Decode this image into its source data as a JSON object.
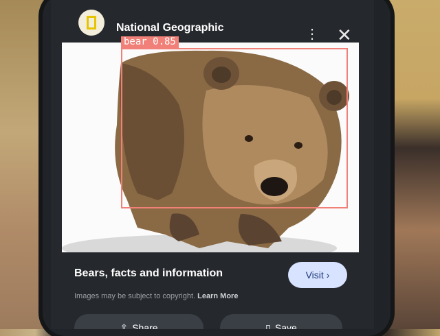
{
  "header": {
    "source_name": "National Geographic",
    "more_icon": "more-vert-icon",
    "close_icon": "close-icon"
  },
  "result": {
    "caption": "Bears, facts and information",
    "visit_label": "Visit",
    "copyright_text": "Images may be subject to copyright.",
    "learn_more": "Learn More"
  },
  "actions": {
    "share_label": "Share",
    "save_label": "Save"
  },
  "detection": {
    "label": "bear 0.85",
    "color": "#f08078"
  },
  "accent": {
    "visit_bg": "#d7e3ff",
    "visit_fg": "#1f3b7a"
  }
}
